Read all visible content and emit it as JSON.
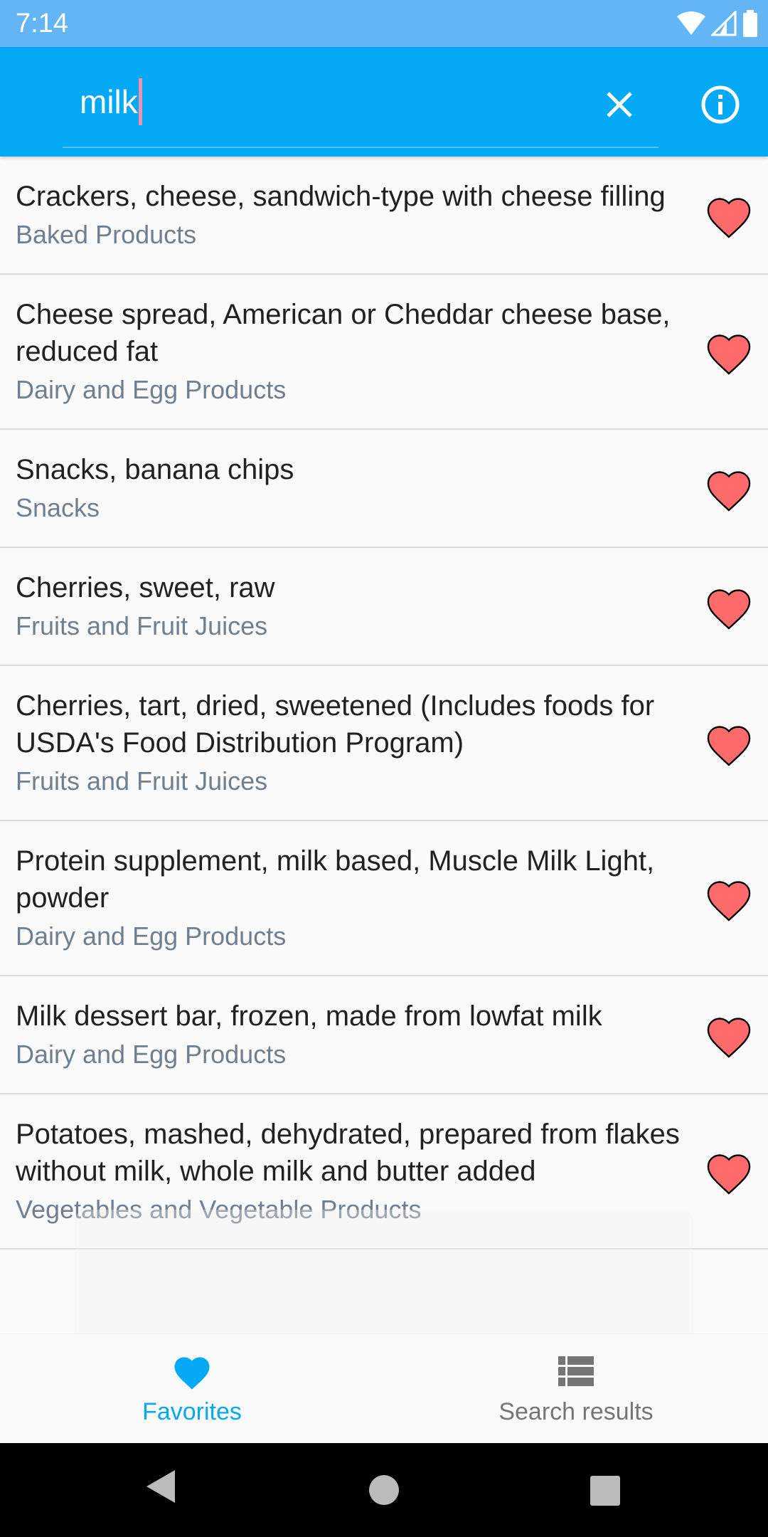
{
  "status_bar": {
    "time": "7:14"
  },
  "search": {
    "query": "milk"
  },
  "colors": {
    "accent": "#03a9f4",
    "status_bar": "#64b5f6",
    "heart_fill": "#ff6b6b",
    "inactive_tab": "#757575"
  },
  "results": [
    {
      "name": "Crackers, cheese, sandwich-type with cheese filling",
      "category": "Baked Products",
      "favorite": true
    },
    {
      "name": "Cheese spread, American or Cheddar cheese base, reduced fat",
      "category": "Dairy and Egg Products",
      "favorite": true
    },
    {
      "name": "Snacks, banana chips",
      "category": "Snacks",
      "favorite": true
    },
    {
      "name": "Cherries, sweet, raw",
      "category": "Fruits and Fruit Juices",
      "favorite": true
    },
    {
      "name": "Cherries, tart, dried, sweetened (Includes foods for USDA's Food Distribution Program)",
      "category": "Fruits and Fruit Juices",
      "favorite": true
    },
    {
      "name": "Protein supplement, milk based, Muscle Milk Light, powder",
      "category": "Dairy and Egg Products",
      "favorite": true
    },
    {
      "name": "Milk dessert bar, frozen, made from lowfat milk",
      "category": "Dairy and Egg Products",
      "favorite": true
    },
    {
      "name": "Potatoes, mashed, dehydrated, prepared from flakes without milk, whole milk and butter added",
      "category": "Vegetables and Vegetable Products",
      "favorite": true
    }
  ],
  "bottom_nav": {
    "tabs": [
      {
        "label": "Favorites",
        "icon": "heart-icon",
        "active": true
      },
      {
        "label": "Search results",
        "icon": "list-icon",
        "active": false
      }
    ]
  }
}
